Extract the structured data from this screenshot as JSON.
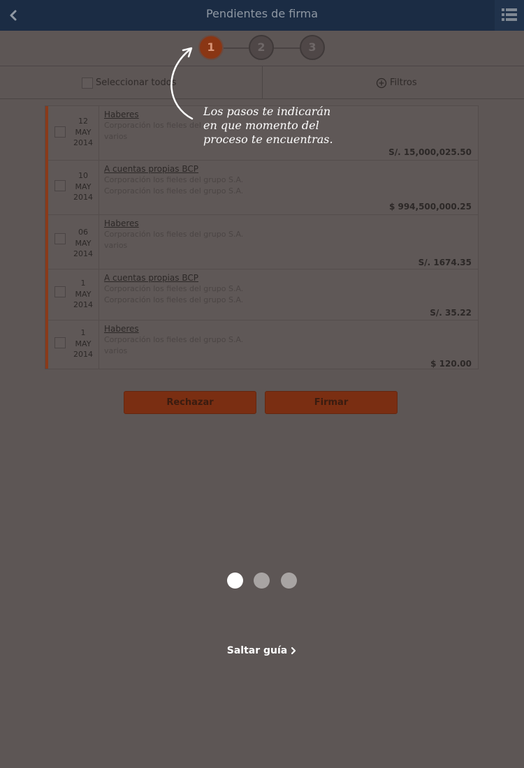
{
  "header": {
    "title": "Pendientes de firma"
  },
  "steps": [
    "1",
    "2",
    "3"
  ],
  "toolbar": {
    "select_all_label": "Seleccionar todos",
    "filters_label": "Filtros"
  },
  "rows": [
    {
      "day": "12",
      "month": "MAY",
      "year": "2014",
      "kind": "Haberes",
      "line1": "Corporación los fieles del",
      "line2": "varios",
      "amount": "S/. 15,000,025.50"
    },
    {
      "day": "10",
      "month": "MAY",
      "year": "2014",
      "kind": "A cuentas propias BCP",
      "line1": "Corporación los fieles del grupo S.A.",
      "line2": "Corporación los fieles del grupo S.A.",
      "amount": "$ 994,500,000.25"
    },
    {
      "day": "06",
      "month": "MAY",
      "year": "2014",
      "kind": "Haberes",
      "line1": "Corporación los fieles del grupo S.A.",
      "line2": "varios",
      "amount": "S/. 1674.35"
    },
    {
      "day": "1",
      "month": "MAY",
      "year": "2014",
      "kind": "A cuentas propias BCP",
      "line1": "Corporación los fieles del grupo S.A.",
      "line2": "Corporación los fieles del grupo S.A.",
      "amount": "S/. 35.22"
    },
    {
      "day": "1",
      "month": "MAY",
      "year": "2014",
      "kind": "Haberes",
      "line1": "Corporación los fieles del grupo S.A.",
      "line2": "varios",
      "amount": "$ 120.00"
    }
  ],
  "actions": {
    "reject_label": "Rechazar",
    "sign_label": "Firmar"
  },
  "overlay": {
    "tip_text": "Los pasos te indicarán\nen que momento del\nproceso te encuentras."
  },
  "guide": {
    "skip_label": "Saltar guía"
  },
  "colors": {
    "header_bg": "#1b2c44",
    "accent": "#8a3614",
    "overlay_bg": "#5d5655"
  }
}
